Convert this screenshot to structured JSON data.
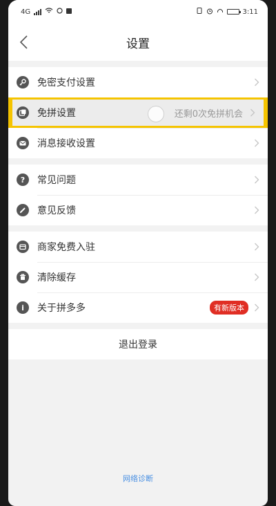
{
  "statusbar": {
    "time": "3:11",
    "network_label": "4G"
  },
  "header": {
    "title": "设置"
  },
  "groups": [
    [
      {
        "key": "pay",
        "label": "免密支付设置",
        "icon": "key-icon"
      },
      {
        "key": "pin",
        "label": "免拼设置",
        "value": "还剩0次免拼机会",
        "icon": "coupon-icon"
      },
      {
        "key": "msg",
        "label": "消息接收设置",
        "icon": "mail-icon"
      }
    ],
    [
      {
        "key": "faq",
        "label": "常见问题",
        "icon": "question-icon"
      },
      {
        "key": "feedback",
        "label": "意见反馈",
        "icon": "pencil-icon"
      }
    ],
    [
      {
        "key": "merchant",
        "label": "商家免费入驻",
        "icon": "store-icon"
      },
      {
        "key": "cache",
        "label": "清除缓存",
        "icon": "trash-icon"
      },
      {
        "key": "about",
        "label": "关于拼多多",
        "badge": "有新版本",
        "icon": "info-icon"
      }
    ]
  ],
  "logout_label": "退出登录",
  "network_diagnosis_label": "网络诊断",
  "colors": {
    "highlight_border": "#f5c400",
    "badge": "#e02e24",
    "link": "#4a90e2"
  }
}
